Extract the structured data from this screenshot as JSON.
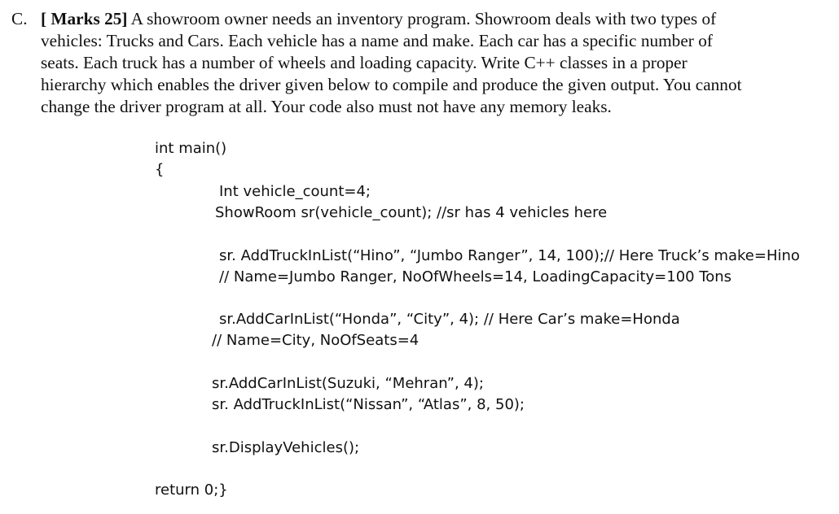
{
  "question": {
    "label": "C.",
    "marks": "[ Marks 25]",
    "first_line_rest": " A showroom owner needs an inventory program. Showroom deals with two types of",
    "lines": [
      "vehicles: Trucks and Cars. Each vehicle has a name and make. Each car has a specific number of",
      "seats. Each truck has a number of wheels and loading capacity. Write C++ classes in a proper",
      "hierarchy which enables the driver given below to compile and produce the given output. You cannot",
      "change the driver program at all. Your code also must not have any memory leaks."
    ]
  },
  "code": {
    "main_sig": "int main()",
    "open_brace": "{",
    "vehicle_count": "Int vehicle_count=4;",
    "showroom": "ShowRoom sr(vehicle_count); //sr has 4 vehicles here",
    "add_truck_1": "sr. AddTruckInList(“Hino”, “Jumbo Ranger”, 14, 100);// Here Truck’s make=Hino",
    "add_truck_1_comment": "// Name=Jumbo Ranger, NoOfWheels=14, LoadingCapacity=100 Tons",
    "add_car_1": "sr.AddCarInList(“Honda”, “City”, 4); // Here Car’s make=Honda",
    "add_car_1_comment": "// Name=City, NoOfSeats=4",
    "add_car_2": "sr.AddCarInList(Suzuki, “Mehran”, 4);",
    "add_truck_2": "sr. AddTruckInList(“Nissan”, “Atlas”, 8, 50);",
    "display": "sr.DisplayVehicles();",
    "return": "return 0;}"
  }
}
